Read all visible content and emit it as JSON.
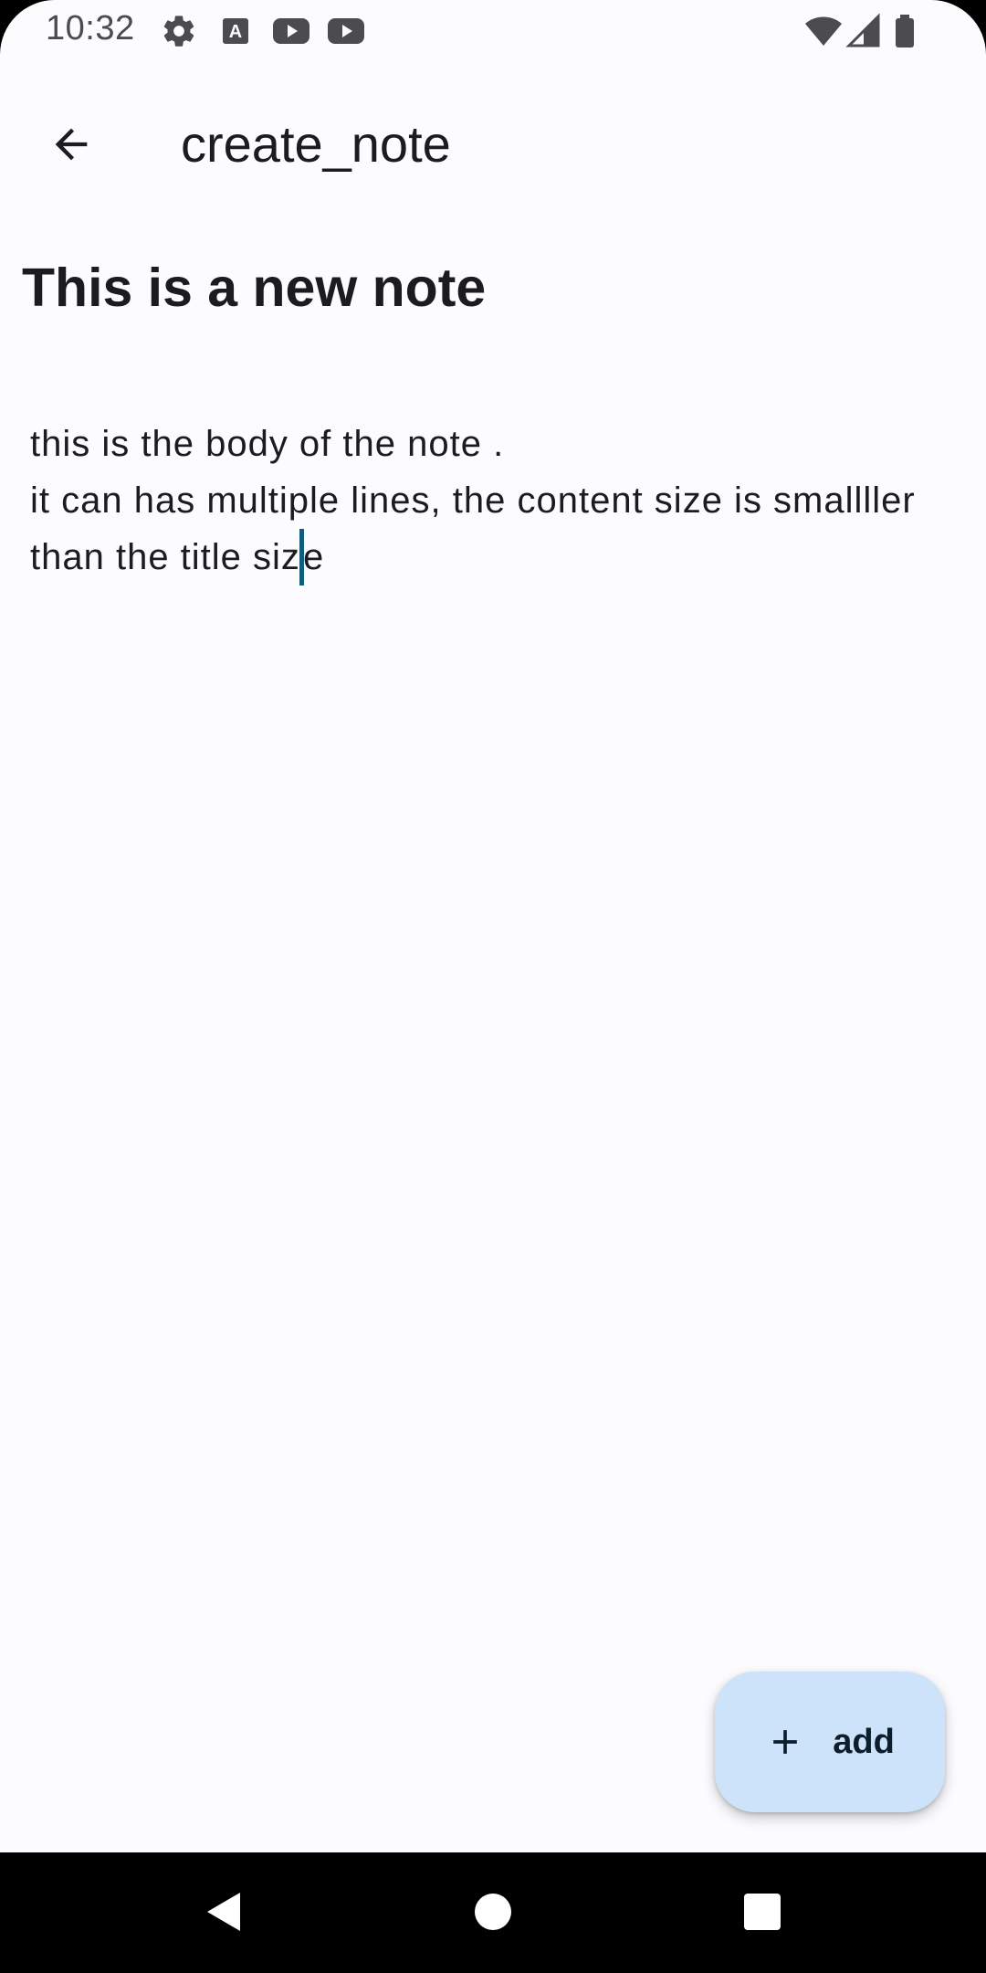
{
  "status_bar": {
    "time": "10:32",
    "icons": [
      "gear-icon",
      "text-a-icon",
      "youtube-icon",
      "youtube-icon",
      "wifi-icon",
      "signal-icon",
      "battery-icon"
    ]
  },
  "app_bar": {
    "title": "create_note",
    "back_icon": "arrow-back-icon"
  },
  "note": {
    "title": "This is a new note",
    "body_lines": [
      "this is the body of the note .",
      "it can has multiple lines, the content size is smallller"
    ],
    "last_line_before_cursor": "than the title siz",
    "last_line_after_cursor": "e"
  },
  "fab": {
    "label": "add",
    "icon": "plus-icon",
    "background": "#cde3fa"
  },
  "nav_bar": {
    "buttons": [
      "back-triangle-icon",
      "home-circle-icon",
      "recents-square-icon"
    ]
  },
  "colors": {
    "background": "#fcfbfe",
    "text": "#1c1b1f",
    "cursor": "#0f5e7c"
  }
}
